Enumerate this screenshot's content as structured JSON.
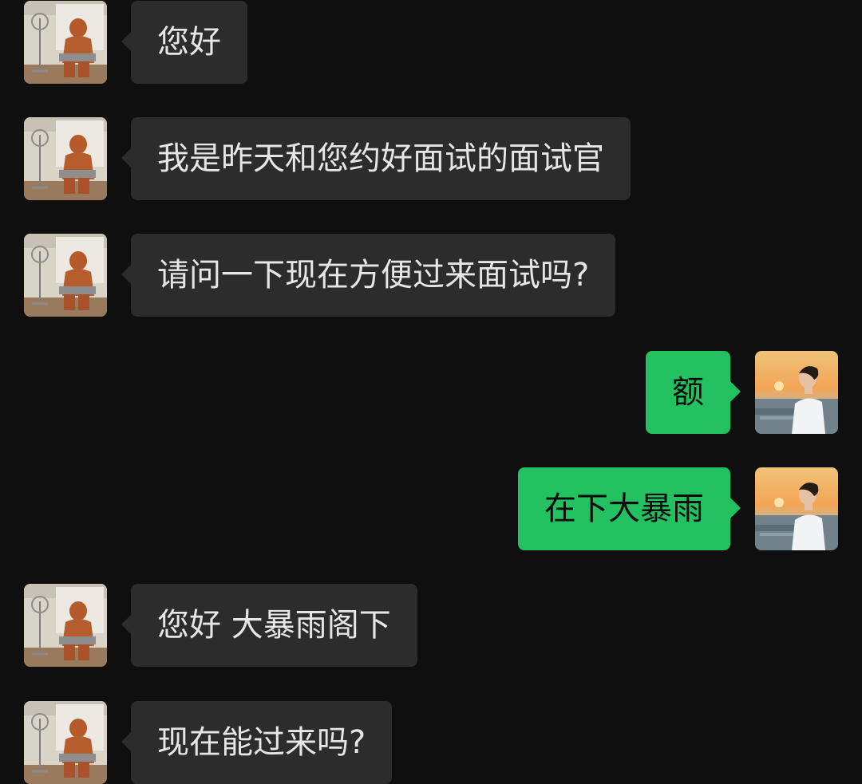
{
  "colors": {
    "background": "#0f0f0f",
    "incoming_bubble": "#2c2c2c",
    "outgoing_bubble": "#23c160",
    "incoming_text": "#e6e6e6",
    "outgoing_text": "#0b0b0b"
  },
  "messages": [
    {
      "sender": "interviewer",
      "avatar_icon": "person-in-brown-suit-avatar-icon",
      "text": "您好"
    },
    {
      "sender": "interviewer",
      "avatar_icon": "person-in-brown-suit-avatar-icon",
      "text": "我是昨天和您约好面试的面试官"
    },
    {
      "sender": "interviewer",
      "avatar_icon": "person-in-brown-suit-avatar-icon",
      "text": "请问一下现在方便过来面试吗?"
    },
    {
      "sender": "me",
      "avatar_icon": "man-at-sunset-avatar-icon",
      "text": "额"
    },
    {
      "sender": "me",
      "avatar_icon": "man-at-sunset-avatar-icon",
      "text": "在下大暴雨"
    },
    {
      "sender": "interviewer",
      "avatar_icon": "person-in-brown-suit-avatar-icon",
      "text": "您好 大暴雨阁下"
    },
    {
      "sender": "interviewer",
      "avatar_icon": "person-in-brown-suit-avatar-icon",
      "text": "现在能过来吗?"
    }
  ]
}
